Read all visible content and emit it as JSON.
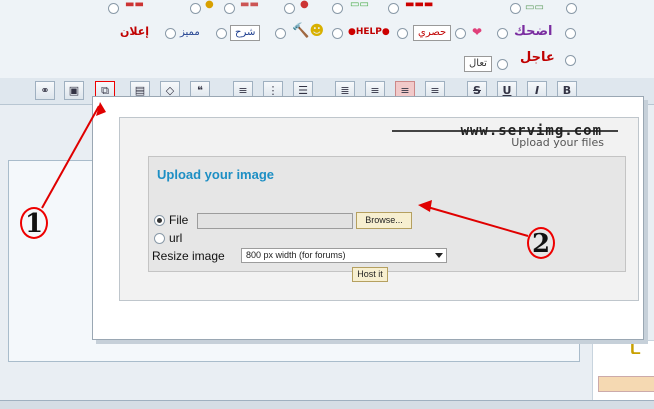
{
  "emoticons": {
    "row1": [
      {
        "label": "إعلان",
        "color": "#c00000"
      },
      {
        "label": "مميز",
        "color": "#1f3f8f"
      },
      {
        "label": "شرح",
        "color": "#1f3f8f"
      },
      {
        "label": "HELP",
        "color": "#c00000"
      },
      {
        "label": "حصري",
        "color": "#c00000"
      },
      {
        "label": "اضحك",
        "color": "#7a2da0"
      }
    ],
    "row2": [
      {
        "label": "عاجل",
        "color": "#c00000"
      },
      {
        "label": "تعال",
        "color": "#333333"
      }
    ]
  },
  "toolbar": {
    "bold": "B",
    "italic": "I",
    "underline": "U",
    "strike": "S"
  },
  "popup": {
    "logo": "www.servimg.com",
    "tagline": "Upload your files",
    "title": "Upload your image",
    "file_label": "File",
    "url_label": "url",
    "resize_label": "Resize image",
    "resize_value": "800 px width (for forums)",
    "browse_label": "Browse...",
    "host_label": "Host it"
  },
  "annotations": {
    "marker1": "1",
    "marker2": "2",
    "arrow_color": "#e00000"
  },
  "side_text": "ـا"
}
